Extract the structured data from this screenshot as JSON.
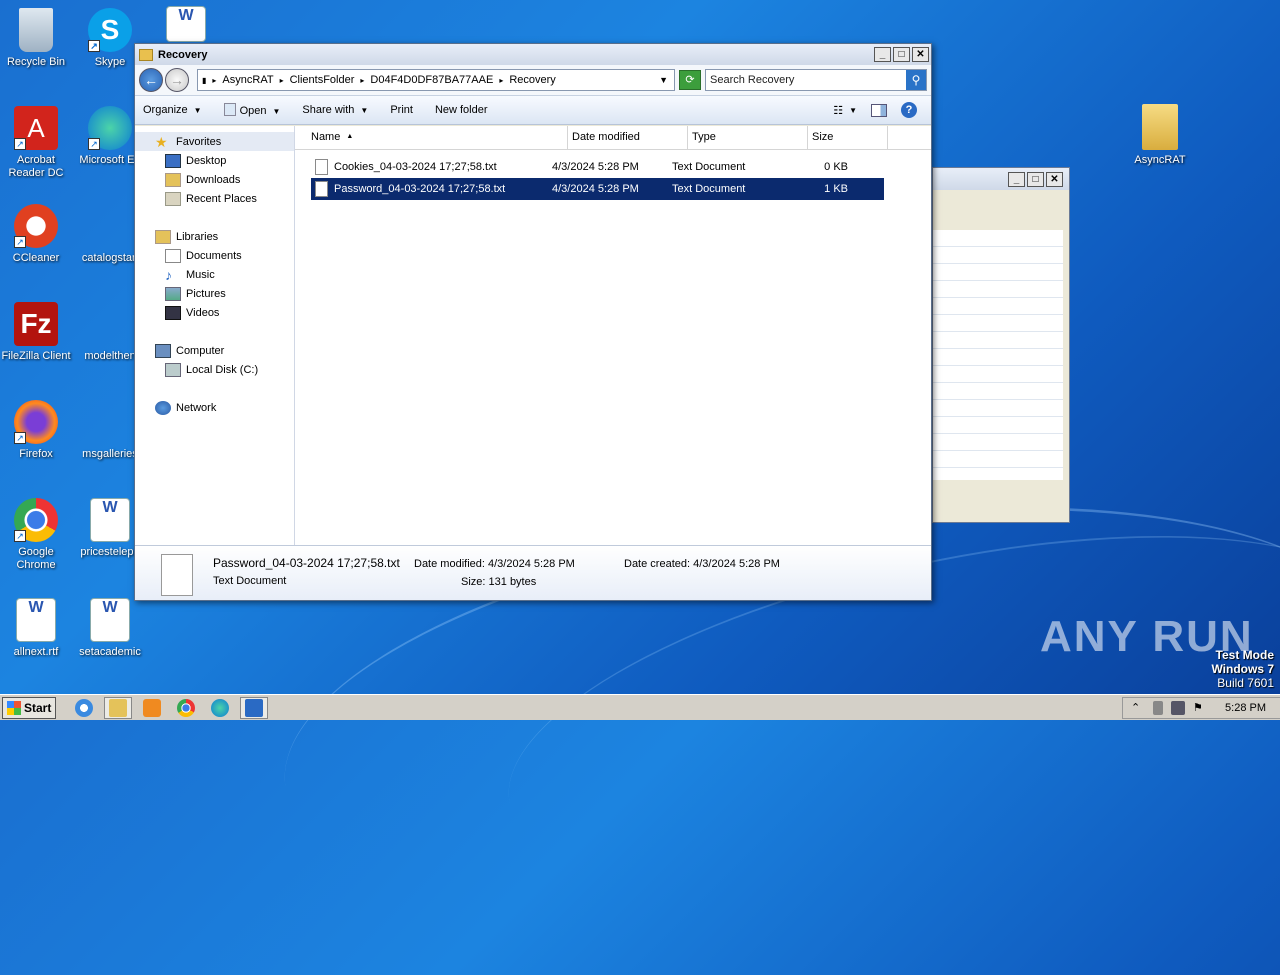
{
  "desktop": {
    "icons": [
      {
        "label": "Recycle Bin"
      },
      {
        "label": "Skype"
      },
      {
        "label": "Acrobat Reader DC"
      },
      {
        "label": "Microsoft Ed"
      },
      {
        "label": "CCleaner"
      },
      {
        "label": "catalogstan"
      },
      {
        "label": "FileZilla Client"
      },
      {
        "label": "modelthen"
      },
      {
        "label": "Firefox"
      },
      {
        "label": "msgalleries"
      },
      {
        "label": "Google Chrome"
      },
      {
        "label": "pricesteleph"
      },
      {
        "label": "allnext.rtf"
      },
      {
        "label": "setacademic"
      },
      {
        "label": "AsyncRAT"
      }
    ]
  },
  "explorer": {
    "title": "Recovery",
    "breadcrumbs": [
      "AsyncRAT",
      "ClientsFolder",
      "D04F4D0DF87BA77AAE",
      "Recovery"
    ],
    "search_placeholder": "Search Recovery",
    "toolbar": {
      "organize": "Organize",
      "open": "Open",
      "share_with": "Share with",
      "print": "Print",
      "new_folder": "New folder"
    },
    "nav": {
      "favorites": "Favorites",
      "desktop": "Desktop",
      "downloads": "Downloads",
      "recent_places": "Recent Places",
      "libraries": "Libraries",
      "documents": "Documents",
      "music": "Music",
      "pictures": "Pictures",
      "videos": "Videos",
      "computer": "Computer",
      "local_disk": "Local Disk (C:)",
      "network": "Network"
    },
    "columns": {
      "name": "Name",
      "date": "Date modified",
      "type": "Type",
      "size": "Size"
    },
    "files": [
      {
        "name": "Cookies_04-03-2024 17;27;58.txt",
        "date": "4/3/2024 5:28 PM",
        "type": "Text Document",
        "size": "0 KB"
      },
      {
        "name": "Password_04-03-2024 17;27;58.txt",
        "date": "4/3/2024 5:28 PM",
        "type": "Text Document",
        "size": "1 KB"
      }
    ],
    "details": {
      "filename": "Password_04-03-2024 17;27;58.txt",
      "type": "Text Document",
      "date_modified_label": "Date modified:",
      "date_modified": "4/3/2024 5:28 PM",
      "size_label": "Size:",
      "size": "131 bytes",
      "date_created_label": "Date created:",
      "date_created": "4/3/2024 5:28 PM"
    }
  },
  "watermark": "ANY RUN",
  "testmode": {
    "line1": "Test Mode",
    "line2": "Windows 7",
    "line3": "Build 7601"
  },
  "taskbar": {
    "start": "Start",
    "clock": "5:28 PM"
  }
}
